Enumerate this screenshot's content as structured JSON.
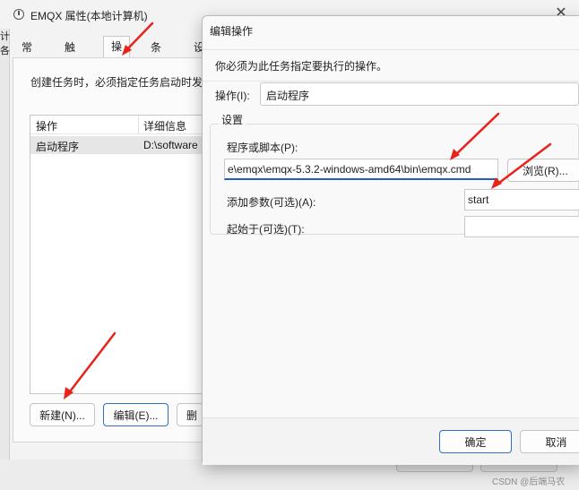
{
  "background_window": {
    "title": "EMQX 属性(本地计算机)",
    "left_strip_chars": [
      "计",
      "各"
    ],
    "tabs": [
      "常规",
      "触发器",
      "操作",
      "条件",
      "设"
    ],
    "active_tab_index": 2,
    "description": "创建任务时，必须指定任务启动时发",
    "list_headers": [
      "操作",
      "详细信息"
    ],
    "list_rows": [
      {
        "action": "启动程序",
        "detail": "D:\\software"
      }
    ],
    "buttons": {
      "new": "新建(N)...",
      "edit": "编辑(E)...",
      "delete": "删"
    }
  },
  "dialog": {
    "title": "编辑操作",
    "close_icon": "close-icon",
    "subtitle": "你必须为此任务指定要执行的操作。",
    "action_label": "操作(I):",
    "action_value": "启动程序",
    "settings_label": "设置",
    "program_label": "程序或脚本(P):",
    "program_value": "e\\emqx\\emqx-5.3.2-windows-amd64\\bin\\emqx.cmd",
    "browse_label": "浏览(R)...",
    "args_label": "添加参数(可选)(A):",
    "args_value": "start",
    "start_in_label": "起始于(可选)(T):",
    "start_in_value": "",
    "ok_label": "确定",
    "cancel_label": "取消"
  },
  "watermark": "CSDN @后端马农",
  "annotation_color": "#e8231a"
}
